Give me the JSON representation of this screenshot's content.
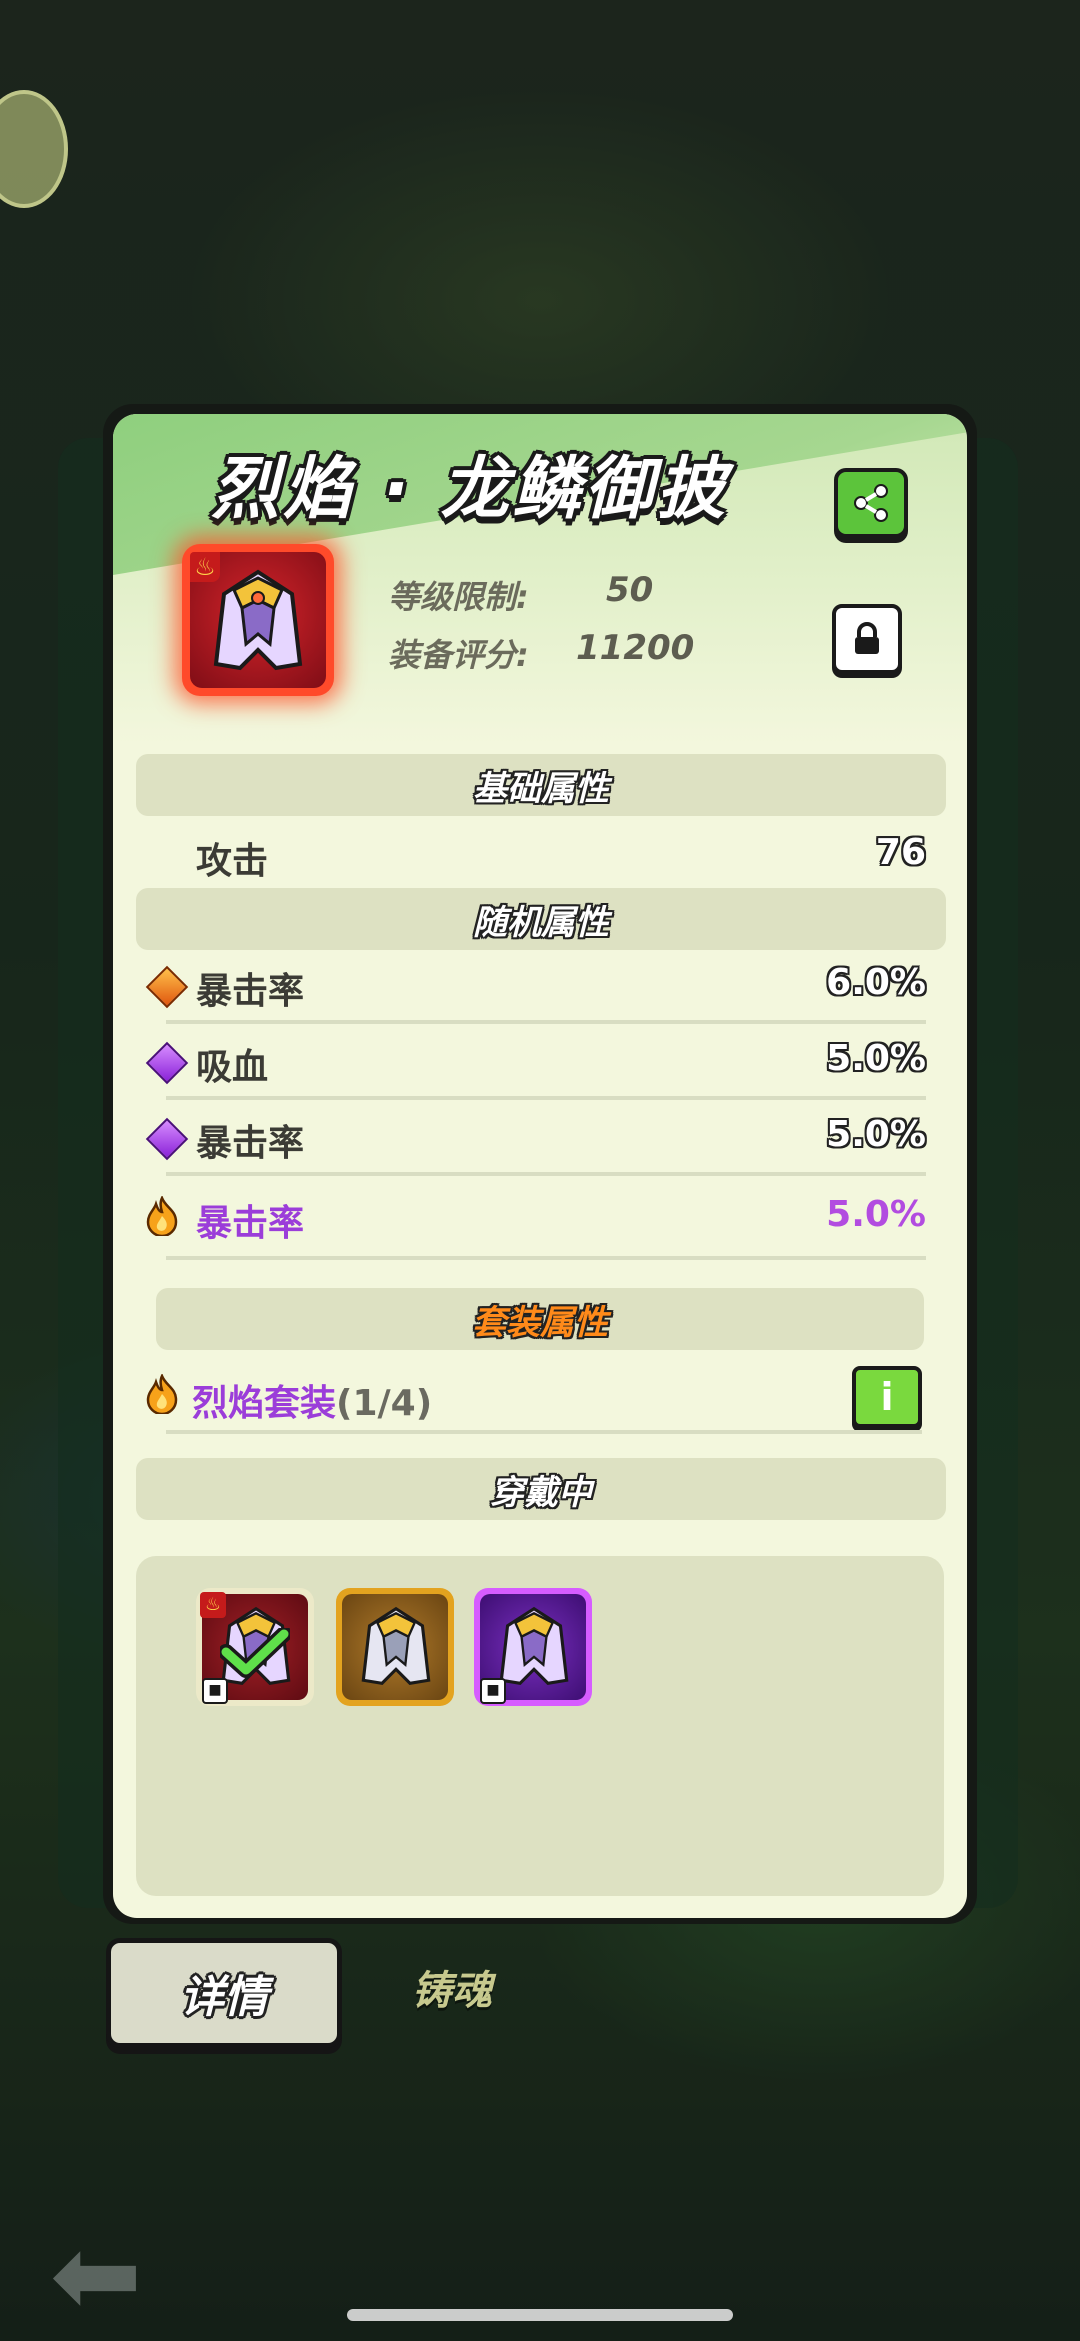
{
  "item": {
    "name": "烈焰 · 龙鳞御披",
    "level_label": "等级限制:",
    "level_value": "50",
    "score_label": "装备评分:",
    "score_value": "11200"
  },
  "sections": {
    "base": "基础属性",
    "random": "随机属性",
    "set": "套装属性",
    "wearing": "穿戴中"
  },
  "base_attrs": [
    {
      "name": "攻击",
      "value": "76"
    }
  ],
  "random_attrs": [
    {
      "icon": "orange-diamond-icon",
      "name": "暴击率",
      "value": "6.0%"
    },
    {
      "icon": "purple-diamond-icon",
      "name": "吸血",
      "value": "5.0%"
    },
    {
      "icon": "purple-diamond-icon",
      "name": "暴击率",
      "value": "5.0%"
    },
    {
      "icon": "fire-icon",
      "name": "暴击率",
      "value": "5.0%"
    }
  ],
  "set": {
    "name": "烈焰套装",
    "count": "(1/4)"
  },
  "tabs": {
    "details": "详情",
    "forge_soul": "铸魂"
  },
  "colors": {
    "panel_bg": "#f3f7dd",
    "section_bg": "#dde1c2",
    "accent_green": "#5cc43b",
    "special_purple": "#9b3dd9",
    "rarity_red": "#ff4a2a",
    "rarity_gold": "#e3a31f",
    "rarity_purple": "#b24ce0"
  }
}
